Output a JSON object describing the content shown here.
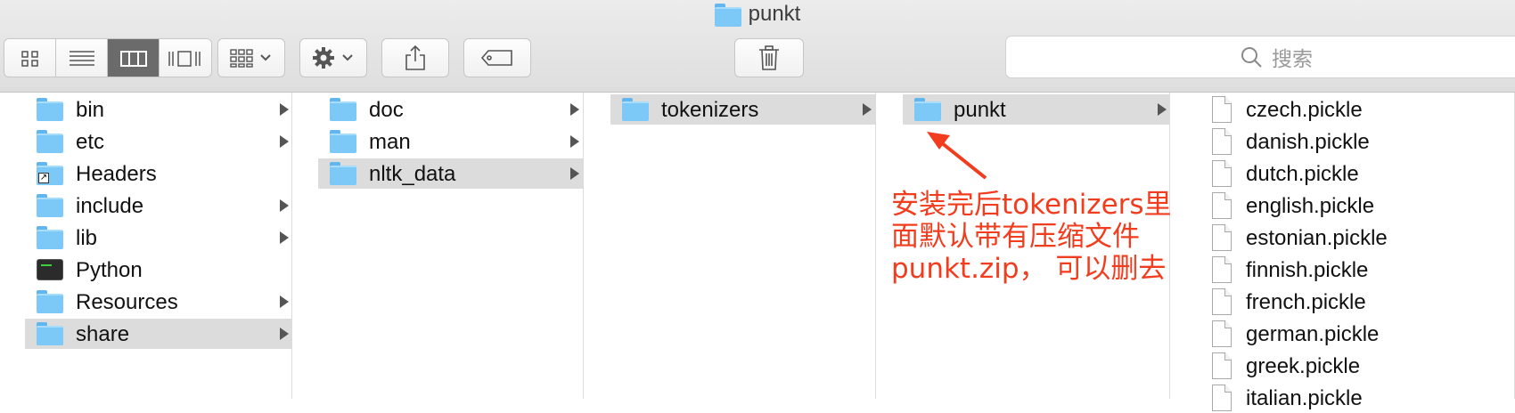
{
  "window": {
    "title": "punkt"
  },
  "toolbar": {
    "view_modes": [
      "icon-view-icon",
      "list-view-icon",
      "column-view-icon",
      "gallery-view-icon"
    ],
    "active_view": 2,
    "search_placeholder": "搜索"
  },
  "columns": [
    {
      "items": [
        {
          "label": "bin",
          "kind": "folder",
          "arrow": true
        },
        {
          "label": "etc",
          "kind": "folder",
          "arrow": true
        },
        {
          "label": "Headers",
          "kind": "alias",
          "arrow": false
        },
        {
          "label": "include",
          "kind": "folder",
          "arrow": true
        },
        {
          "label": "lib",
          "kind": "folder",
          "arrow": true
        },
        {
          "label": "Python",
          "kind": "exec",
          "arrow": false
        },
        {
          "label": "Resources",
          "kind": "folder",
          "arrow": true
        },
        {
          "label": "share",
          "kind": "folder",
          "arrow": true,
          "selected": true
        }
      ]
    },
    {
      "items": [
        {
          "label": "doc",
          "kind": "folder",
          "arrow": true
        },
        {
          "label": "man",
          "kind": "folder",
          "arrow": true
        },
        {
          "label": "nltk_data",
          "kind": "folder",
          "arrow": true,
          "selected": true
        }
      ]
    },
    {
      "items": [
        {
          "label": "tokenizers",
          "kind": "folder",
          "arrow": true,
          "selected": true
        }
      ]
    },
    {
      "items": [
        {
          "label": "punkt",
          "kind": "folder",
          "arrow": true,
          "selected": true
        }
      ]
    },
    {
      "items": [
        {
          "label": "czech.pickle",
          "kind": "file"
        },
        {
          "label": "danish.pickle",
          "kind": "file"
        },
        {
          "label": "dutch.pickle",
          "kind": "file"
        },
        {
          "label": "english.pickle",
          "kind": "file"
        },
        {
          "label": "estonian.pickle",
          "kind": "file"
        },
        {
          "label": "finnish.pickle",
          "kind": "file"
        },
        {
          "label": "french.pickle",
          "kind": "file"
        },
        {
          "label": "german.pickle",
          "kind": "file"
        },
        {
          "label": "greek.pickle",
          "kind": "file"
        },
        {
          "label": "italian.pickle",
          "kind": "file"
        }
      ]
    }
  ],
  "annotation": {
    "lines": [
      "安装完后tokenizers里",
      "面默认带有压缩文件",
      "punkt.zip， 可以删去"
    ],
    "color": "#f23c1e"
  }
}
